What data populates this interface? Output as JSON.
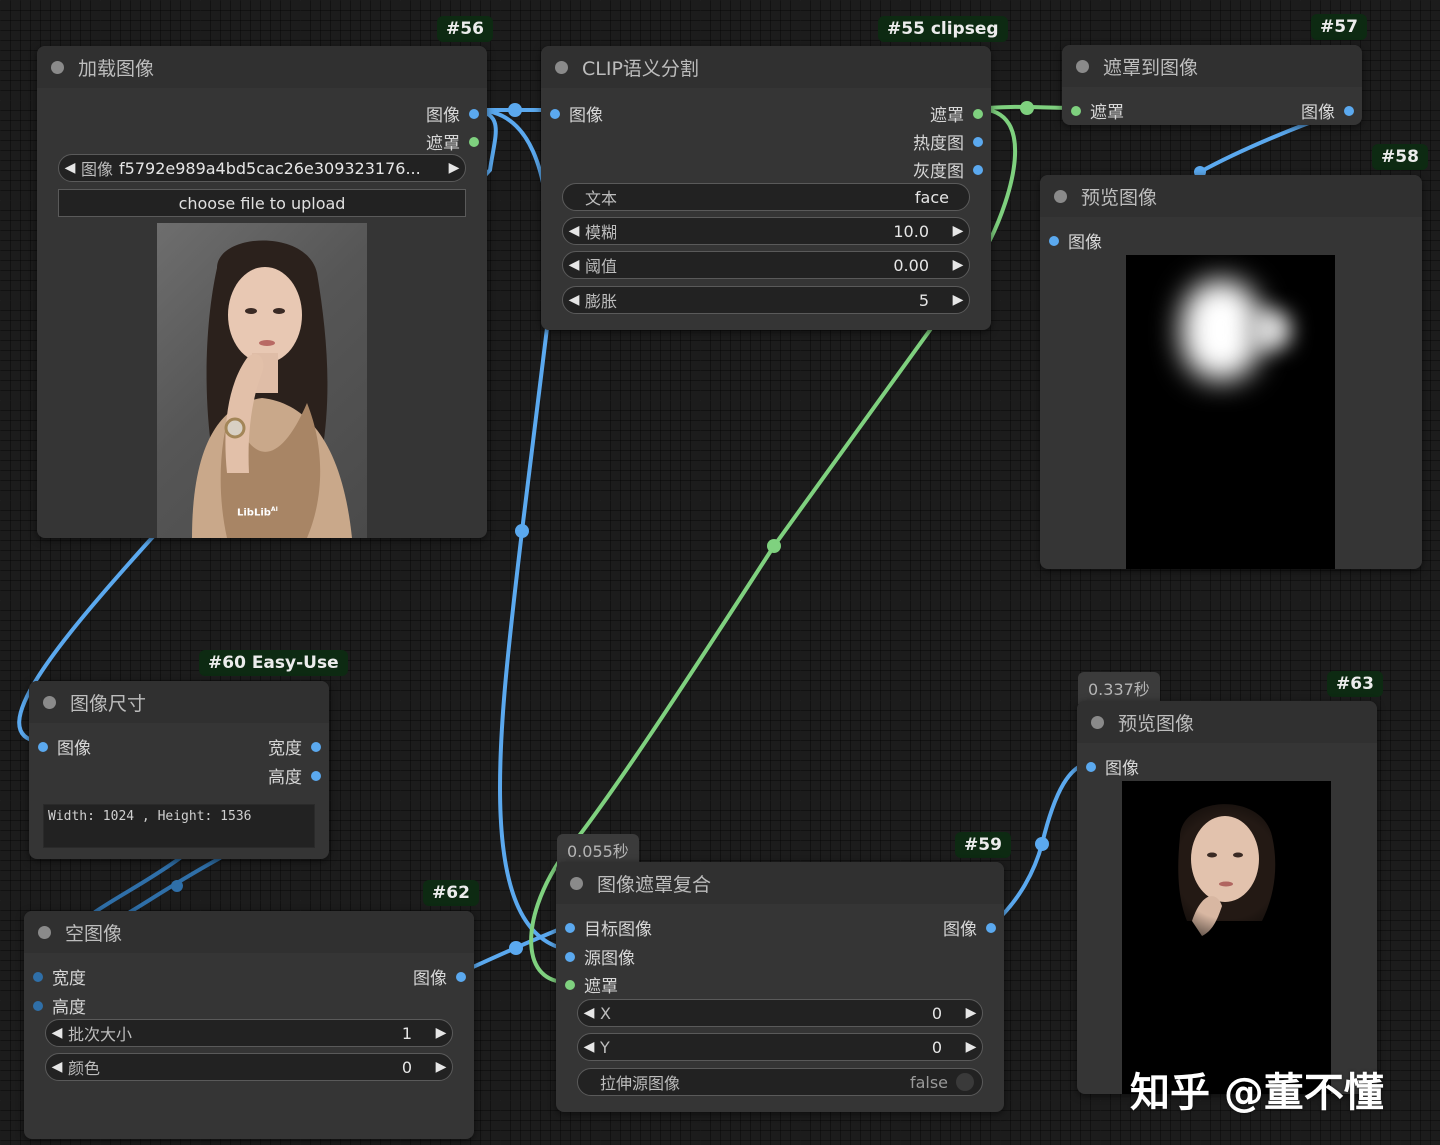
{
  "nodes": {
    "load_image": {
      "badge": "#56",
      "title": "加载图像",
      "outputs": [
        "图像",
        "遮罩"
      ],
      "image_label": "图像",
      "image_value": "f5792e989a4bd5cac26e309323176...",
      "upload_label": "choose file to upload",
      "preview_brand": "LibLib",
      "preview_brand_sub": "AI"
    },
    "clipseg": {
      "badge": "#55 clipseg",
      "title": "CLIP语义分割",
      "input": "图像",
      "outputs": [
        "遮罩",
        "热度图",
        "灰度图"
      ],
      "text_label": "文本",
      "text_value": "face",
      "widgets": [
        {
          "label": "模糊",
          "value": "10.0"
        },
        {
          "label": "阈值",
          "value": "0.00"
        },
        {
          "label": "膨胀",
          "value": "5"
        }
      ]
    },
    "mask_to_image": {
      "badge": "#57",
      "title": "遮罩到图像",
      "input": "遮罩",
      "output": "图像"
    },
    "preview_58": {
      "badge": "#58",
      "title": "预览图像",
      "input": "图像"
    },
    "image_size": {
      "badge": "#60 Easy-Use",
      "title": "图像尺寸",
      "input": "图像",
      "outputs": [
        "宽度",
        "高度"
      ],
      "info": "Width: 1024 , Height: 1536"
    },
    "empty_image": {
      "badge": "#62",
      "title": "空图像",
      "inputs": [
        "宽度",
        "高度"
      ],
      "output": "图像",
      "widgets": [
        {
          "label": "批次大小",
          "value": "1"
        },
        {
          "label": "颜色",
          "value": "0"
        }
      ]
    },
    "composite": {
      "badge": "#59",
      "timer": "0.055秒",
      "title": "图像遮罩复合",
      "inputs": [
        "目标图像",
        "源图像",
        "遮罩"
      ],
      "output": "图像",
      "widgets": [
        {
          "label": "X",
          "value": "0"
        },
        {
          "label": "Y",
          "value": "0"
        }
      ],
      "toggle_label": "拉伸源图像",
      "toggle_value": "false"
    },
    "preview_63": {
      "badge": "#63",
      "timer": "0.337秒",
      "title": "预览图像",
      "input": "图像"
    }
  },
  "watermark": "知乎 @董不懂",
  "colors": {
    "image_link": "#5ba9ef",
    "mask_link": "#7fd17f",
    "node_bg": "#353535",
    "badge_bg": "#0d2a12"
  }
}
